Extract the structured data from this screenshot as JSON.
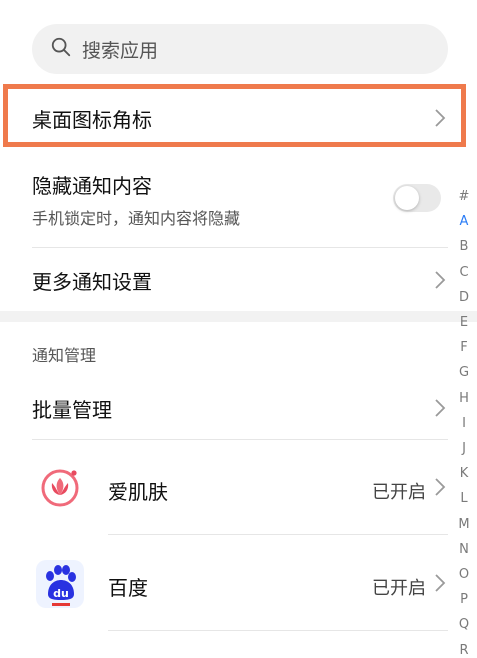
{
  "search": {
    "placeholder": "搜索应用",
    "icon": "search-icon"
  },
  "settings": {
    "badge_row": {
      "title": "桌面图标角标"
    },
    "hide_row": {
      "title": "隐藏通知内容",
      "subtitle": "手机锁定时，通知内容将隐藏",
      "toggle_on": false
    },
    "more_row": {
      "title": "更多通知设置"
    }
  },
  "manage": {
    "section_label": "通知管理",
    "batch_title": "批量管理",
    "apps": [
      {
        "name": "爱肌肤",
        "status": "已开启",
        "icon": "aijifu-app-icon"
      },
      {
        "name": "百度",
        "status": "已开启",
        "icon": "baidu-app-icon"
      }
    ]
  },
  "index_letters": [
    "#",
    "A",
    "B",
    "C",
    "D",
    "E",
    "F",
    "G",
    "H",
    "I",
    "J",
    "K",
    "L",
    "M",
    "N",
    "O",
    "P",
    "Q",
    "R"
  ],
  "colors": {
    "highlight": "#ef7a4c",
    "index_active": "#2a7cf6",
    "baidu_blue": "#2932e1"
  }
}
